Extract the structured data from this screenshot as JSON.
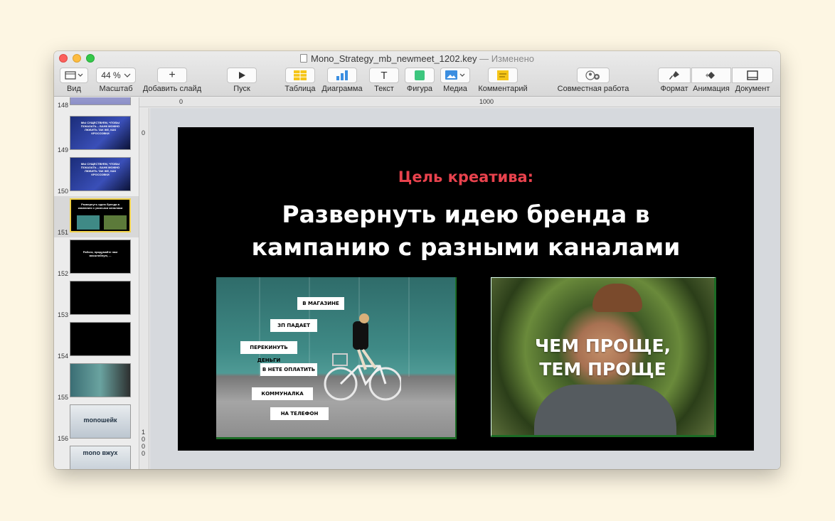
{
  "window": {
    "title": "Mono_Strategy_mb_newmeet_1202.key",
    "status": "— Изменено"
  },
  "toolbar": {
    "view_label": "Вид",
    "zoom_value": "44 %",
    "zoom_label": "Масштаб",
    "add_slide_label": "Добавить слайд",
    "play_label": "Пуск",
    "table_label": "Таблица",
    "chart_label": "Диаграмма",
    "text_label": "Текст",
    "shape_label": "Фигура",
    "media_label": "Медиа",
    "comment_label": "Комментарий",
    "collab_label": "Совместная работа",
    "format_label": "Формат",
    "animate_label": "Анимация",
    "document_label": "Документ",
    "text_glyph": "T",
    "add_glyph": "+"
  },
  "rulers": {
    "h_marks": [
      "0",
      "1000"
    ],
    "v_mark_top": "0",
    "v_mark_bottom": [
      "1",
      "0",
      "0",
      "0"
    ]
  },
  "navigator": {
    "slides": [
      {
        "num": "148",
        "text": ""
      },
      {
        "num": "149",
        "text": "МЫ СУЩЕСТВУЕМ, ЧТОБЫ ПОКАЗАТЬ – БАНК МОЖНО ЛЮБИТЬ ТАК ЖЕ, КАК КРОССОВКИ"
      },
      {
        "num": "150",
        "text": "МЫ СУЩЕСТВУЕМ, ЧТОБЫ ПОКАЗАТЬ – БАНК МОЖНО ЛЮБИТЬ ТАК ЖЕ, КАК КРОССОВКИ"
      },
      {
        "num": "151",
        "text": "Развернуть идею бренда в кампанию с разными каналами"
      },
      {
        "num": "152",
        "text": "Рабога, придумайте нам масштабную, ..."
      },
      {
        "num": "153",
        "text": ""
      },
      {
        "num": "154",
        "text": ""
      },
      {
        "num": "155",
        "text": ""
      },
      {
        "num": "156",
        "text": "monoшейк"
      },
      {
        "num": "157",
        "text": "mono вжух"
      }
    ]
  },
  "slide": {
    "subtitle": "Цель креатива:",
    "title_line1": "Развернуть идею бренда в",
    "title_line2": "кампанию с разными каналами",
    "chips": [
      "В МАГАЗИНЕ",
      "ЗП ПАДАЕТ",
      "ПЕРЕКИНУТЬ ДЕНЬГИ",
      "В НЕТЕ ОПЛАТИТЬ",
      "КОММУНАЛКА",
      "НА ТЕЛЕФОН"
    ],
    "overlay_line1": "ЧЕМ ПРОЩЕ,",
    "overlay_line2": "ТЕМ ПРОЩЕ"
  },
  "colors": {
    "accent_red": "#e8424d",
    "slide_bg": "#000000",
    "selection_yellow": "#f2d34b",
    "photo_border_green": "#1c6b25"
  }
}
